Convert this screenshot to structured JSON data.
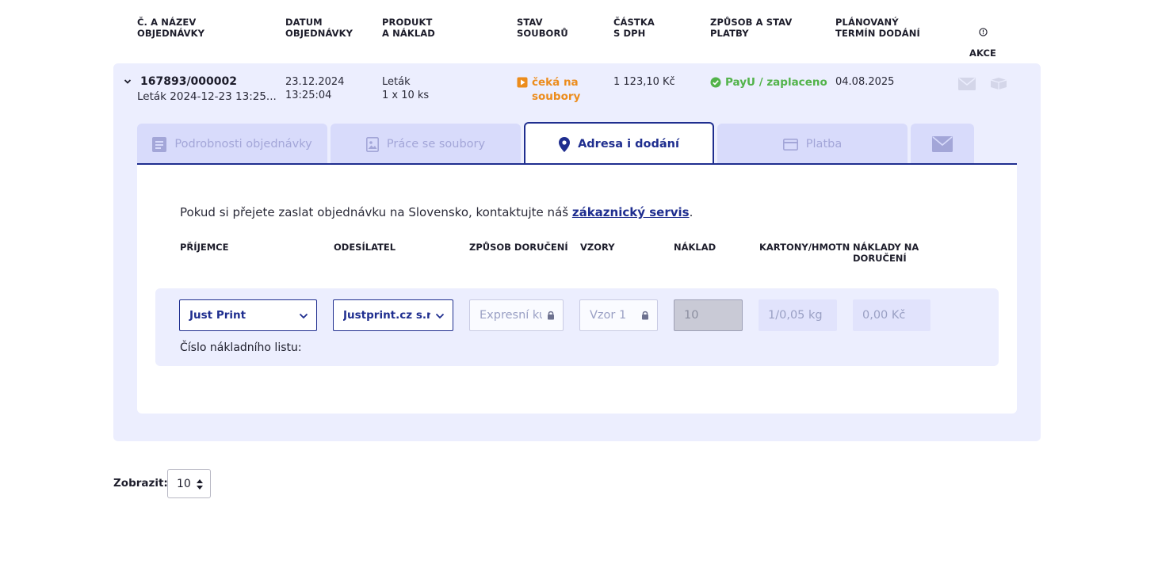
{
  "header": {
    "col_order": "Č. A NÁZEV\nOBJEDNÁVKY",
    "col_date": "DATUM\nOBJEDNÁVKY",
    "col_product": "PRODUKT\nA NÁKLAD",
    "col_files": "STAV\nSOUBORŮ",
    "col_amount": "ČÁSTKA\nS DPH",
    "col_payment": "ZPŮSOB A STAV\nPLATBY",
    "col_delivery": "PLÁNOVANÝ\nTERMÍN DODÁNÍ",
    "col_actions": "AKCE"
  },
  "order": {
    "number": "167893/000002",
    "name": "Leták 2024-12-23 13:25...",
    "date": "23.12.2024\n13:25:04",
    "product": "Leták\n1 x 10 ks",
    "file_status": "čeká na\nsoubory",
    "amount": "1 123,10 Kč",
    "payment": "PayU / zaplaceno",
    "delivery_date": "04.08.2025",
    "actions_icons": [
      "envelope-icon",
      "package-icon"
    ]
  },
  "tabs": [
    {
      "label": "Podrobnosti objednávky",
      "icon": "document-icon",
      "active": false
    },
    {
      "label": "Práce se soubory",
      "icon": "image-icon",
      "active": false
    },
    {
      "label": "Adresa i dodání",
      "icon": "map-pin-icon",
      "active": true
    },
    {
      "label": "Platba",
      "icon": "credit-card-icon",
      "active": false
    },
    {
      "label": "",
      "icon": "envelope-icon",
      "active": false
    }
  ],
  "delivery": {
    "notice_text": "Pokud si přejete zaslat objednávku na Slovensko, kontaktujte náš ",
    "notice_link": "zákaznický servis",
    "notice_end": ".",
    "columns": {
      "recipient": "PŘÍJEMCE",
      "sender": "ODESÍLATEL",
      "method": "ZPŮSOB DORUČENÍ",
      "samples": "VZORY",
      "quantity": "NÁKLAD",
      "cartons": "KARTONY/HMOTN",
      "cost": "NÁKLADY NA\nDORUČENÍ"
    },
    "row": {
      "recipient": "Just Print",
      "sender": "Justprint.cz s.r.o., ",
      "method": "Expresní kurýr",
      "samples": "Vzor 1",
      "quantity": "10",
      "cartons": "1/0,05 kg",
      "cost": "0,00 Kč",
      "waybill_label": "Číslo nákladního listu:"
    }
  },
  "footer": {
    "show_label": "Zobrazit:",
    "page_size": "10"
  },
  "colors": {
    "primary": "#1f2e8f",
    "card_bg": "#eceefe",
    "file_status": "#ec8c1c",
    "paid": "#52b34a"
  }
}
